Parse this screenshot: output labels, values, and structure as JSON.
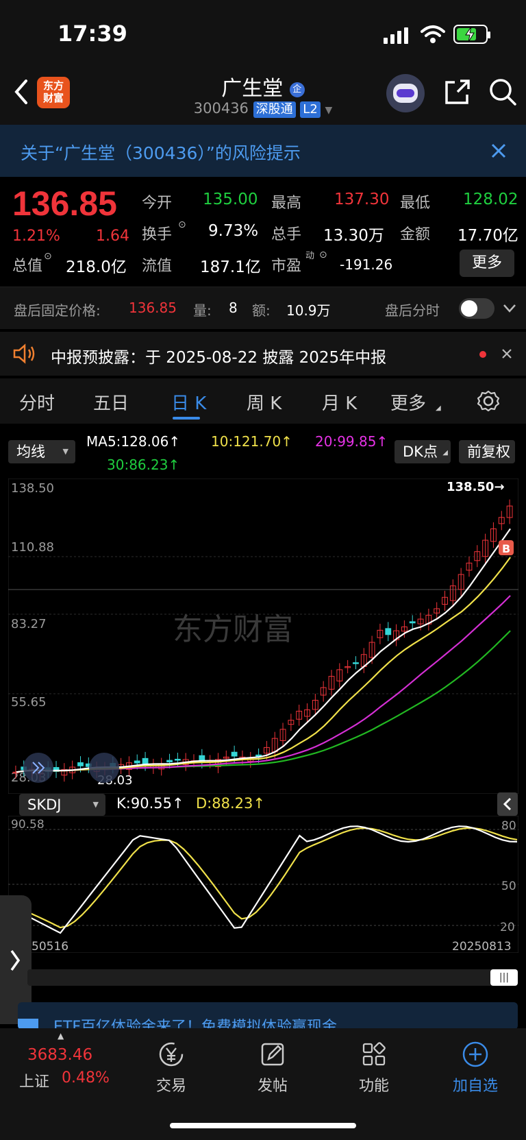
{
  "status": {
    "time": "17:39"
  },
  "header": {
    "logo_line1": "东方",
    "logo_line2": "财富",
    "stock_name": "广生堂",
    "name_badge": "企",
    "stock_code": "300436",
    "tag_connect": "深股通",
    "tag_level": "L2"
  },
  "risk": {
    "text": "关于“广生堂（300436）”的风险提示"
  },
  "quote": {
    "price": "136.85",
    "change_pct": "1.21%",
    "change": "1.64",
    "open_label": "今开",
    "open": "135.00",
    "high_label": "最高",
    "high": "137.30",
    "low_label": "最低",
    "low": "128.02",
    "turnover_label": "换手",
    "turnover": "9.73%",
    "volume_label": "总手",
    "volume": "13.30万",
    "amount_label": "金额",
    "amount": "17.70亿",
    "mktcap_label": "总值",
    "mktcap": "218.0亿",
    "float_label": "流值",
    "float": "187.1亿",
    "pe_label": "市盈",
    "pe_sup": "动",
    "pe": "-191.26",
    "more": "更多"
  },
  "afterhours": {
    "price_label": "盘后固定价格:",
    "price": "136.85",
    "vol_label": "量:",
    "vol": "8",
    "amt_label": "额:",
    "amt": "10.9万",
    "intraday_label": "盘后分时"
  },
  "notice": {
    "text": "中报预披露：于 2025-08-22 披露 2025年中报"
  },
  "tabs": [
    "分时",
    "五日",
    "日 K",
    "周 K",
    "月 K",
    "更多"
  ],
  "ma_row": {
    "dropdown": "均线",
    "ma5": "MA5:128.06↑",
    "ma10": "10:121.70↑",
    "ma20": "20:99.85↑",
    "ma30": "30:86.23↑",
    "dk": "DK点",
    "adjust": "前复权"
  },
  "chart": {
    "watermark": "东方财富",
    "y_labels": [
      "138.50",
      "110.88",
      "83.27",
      "55.65",
      "28.03"
    ],
    "max_label": "138.50→",
    "min_label": "28.03",
    "b_marker": "B",
    "colors": {
      "up": "#f0343a",
      "down": "#35d6d6",
      "ma5": "#ffffff",
      "ma10": "#f0e14a",
      "ma20": "#d42fd4",
      "ma30": "#22b822"
    }
  },
  "kdj": {
    "dropdown": "SKDJ",
    "k": "K:90.55↑",
    "d": "D:88.23↑",
    "top_label": "90.58",
    "right_labels": [
      "80",
      "50",
      "20"
    ],
    "date_start": "50516",
    "date_end": "20250813"
  },
  "promo": {
    "text": "ETF百亿体验金来了！免费模拟体验赢现金"
  },
  "bottom": {
    "index_value": "3683.46",
    "index_name": "上证",
    "index_change": "0.48%",
    "nav": [
      "交易",
      "发帖",
      "功能",
      "加自选"
    ]
  }
}
